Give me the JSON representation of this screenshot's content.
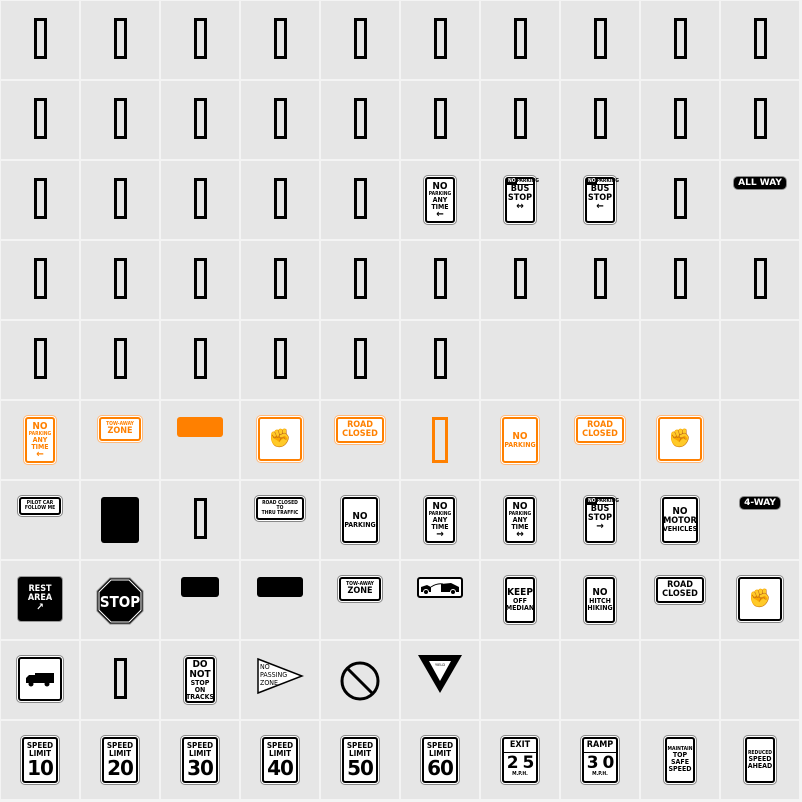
{
  "font_preview": {
    "background": "#e6e6e6",
    "accent_orange": "#ff8000",
    "columns": 10,
    "rows": 10,
    "cells": [
      {
        "type": "missing"
      },
      {
        "type": "missing"
      },
      {
        "type": "missing"
      },
      {
        "type": "missing"
      },
      {
        "type": "missing"
      },
      {
        "type": "missing"
      },
      {
        "type": "missing"
      },
      {
        "type": "missing"
      },
      {
        "type": "missing"
      },
      {
        "type": "missing"
      },
      {
        "type": "missing"
      },
      {
        "type": "missing"
      },
      {
        "type": "missing"
      },
      {
        "type": "missing"
      },
      {
        "type": "missing"
      },
      {
        "type": "missing"
      },
      {
        "type": "missing"
      },
      {
        "type": "missing"
      },
      {
        "type": "missing"
      },
      {
        "type": "missing"
      },
      {
        "type": "missing"
      },
      {
        "type": "missing"
      },
      {
        "type": "missing"
      },
      {
        "type": "missing"
      },
      {
        "type": "missing"
      },
      {
        "type": "sign",
        "name": "no-parking-any-time-left",
        "lines": [
          "NO",
          "PARKING",
          "ANY",
          "TIME"
        ],
        "arrow": "←"
      },
      {
        "type": "bus",
        "name": "no-parking-bus-stop-both",
        "head_no": "NO",
        "head": "PARKING",
        "lines": [
          "BUS",
          "STOP"
        ],
        "arrow": "↔"
      },
      {
        "type": "bus",
        "name": "no-parking-bus-stop-left",
        "head_no": "NO",
        "head": "PARKING",
        "lines": [
          "BUS",
          "STOP"
        ],
        "arrow": "←"
      },
      {
        "type": "missing"
      },
      {
        "type": "pill",
        "name": "all-way",
        "lines": [
          "ALL WAY"
        ]
      },
      {
        "type": "missing"
      },
      {
        "type": "missing"
      },
      {
        "type": "missing"
      },
      {
        "type": "missing"
      },
      {
        "type": "missing"
      },
      {
        "type": "missing"
      },
      {
        "type": "missing"
      },
      {
        "type": "missing"
      },
      {
        "type": "missing"
      },
      {
        "type": "missing"
      },
      {
        "type": "missing"
      },
      {
        "type": "missing"
      },
      {
        "type": "missing"
      },
      {
        "type": "missing"
      },
      {
        "type": "missing"
      },
      {
        "type": "missing"
      },
      {
        "type": "empty"
      },
      {
        "type": "empty"
      },
      {
        "type": "empty"
      },
      {
        "type": "empty"
      },
      {
        "type": "sign",
        "color": "orange",
        "name": "no-parking-any-time-left-orange",
        "lines": [
          "NO",
          "PARKING",
          "ANY",
          "TIME"
        ],
        "arrow": "←"
      },
      {
        "type": "wide",
        "color": "orange",
        "name": "tow-away-zone-orange",
        "lines": [
          "TOW-AWAY",
          "ZONE"
        ]
      },
      {
        "type": "block",
        "color": "orange",
        "name": "blank-panel-orange"
      },
      {
        "type": "hand",
        "color": "orange",
        "name": "hitchhiker-orange",
        "icon": "👍"
      },
      {
        "type": "wide",
        "color": "orange",
        "name": "road-closed-orange",
        "lines": [
          "ROAD",
          "CLOSED"
        ]
      },
      {
        "type": "missing",
        "color": "orange"
      },
      {
        "type": "square",
        "color": "orange",
        "name": "no-parking-orange",
        "lines": [
          "NO",
          "PARKING"
        ]
      },
      {
        "type": "wide",
        "color": "orange",
        "name": "road-closed-orange-2",
        "lines": [
          "ROAD",
          "CLOSED"
        ]
      },
      {
        "type": "hand",
        "color": "orange",
        "name": "hitchhiker-orange-2",
        "icon": "👍"
      },
      {
        "type": "empty"
      },
      {
        "type": "wide",
        "name": "pilot-car-follow-me",
        "lines": [
          "PILOT CAR",
          "FOLLOW ME"
        ]
      },
      {
        "type": "bigblock",
        "name": "blank-black-panel"
      },
      {
        "type": "missing"
      },
      {
        "type": "wide",
        "name": "road-closed-to-thru-traffic",
        "lines": [
          "ROAD CLOSED",
          "TO",
          "THRU TRAFFIC"
        ]
      },
      {
        "type": "square",
        "name": "no-parking",
        "lines": [
          "NO",
          "PARKING"
        ]
      },
      {
        "type": "sign",
        "name": "no-parking-any-time-right",
        "lines": [
          "NO",
          "PARKING",
          "ANY",
          "TIME"
        ],
        "arrow": "→"
      },
      {
        "type": "sign",
        "name": "no-parking-any-time-both",
        "lines": [
          "NO",
          "PARKING",
          "ANY",
          "TIME"
        ],
        "arrow": "↔"
      },
      {
        "type": "bus",
        "name": "no-parking-bus-stop-right",
        "head_no": "NO",
        "head": "PARKING",
        "lines": [
          "BUS",
          "STOP"
        ],
        "arrow": "→"
      },
      {
        "type": "square",
        "name": "no-motor-vehicles",
        "lines": [
          "NO",
          "MOTOR",
          "VEHICLES"
        ]
      },
      {
        "type": "pill",
        "name": "four-way",
        "lines": [
          "4-WAY"
        ]
      },
      {
        "type": "blacksq",
        "name": "rest-area",
        "lines": [
          "REST",
          "AREA"
        ],
        "arrow": "↗"
      },
      {
        "type": "stop",
        "name": "stop",
        "lines": [
          "STOP"
        ]
      },
      {
        "type": "block",
        "name": "blank-black-small"
      },
      {
        "type": "block",
        "name": "blank-black-wide"
      },
      {
        "type": "wide",
        "name": "tow-away-zone",
        "lines": [
          "TOW-AWAY",
          "ZONE"
        ]
      },
      {
        "type": "tow",
        "name": "tow-truck",
        "icon": "🚚"
      },
      {
        "type": "sign",
        "name": "keep-off-median",
        "lines": [
          "KEEP",
          "OFF",
          "MEDIAN"
        ]
      },
      {
        "type": "sign",
        "name": "no-hitch-hiking",
        "lines": [
          "NO",
          "HITCH",
          "HIKING"
        ]
      },
      {
        "type": "wide",
        "name": "road-closed",
        "lines": [
          "ROAD",
          "CLOSED"
        ]
      },
      {
        "type": "hand",
        "name": "hitchhiker",
        "icon": "👍"
      },
      {
        "type": "truck",
        "name": "truck-route",
        "icon": "🚚"
      },
      {
        "type": "missing"
      },
      {
        "type": "sign",
        "name": "do-not-stop-on-tracks",
        "lines": [
          "DO NOT",
          "STOP",
          "ON",
          "TRACKS"
        ]
      },
      {
        "type": "pennant",
        "name": "no-passing-zone",
        "lines": [
          "NO",
          "PASSING",
          "ZONE"
        ]
      },
      {
        "type": "prohibit",
        "name": "prohibition-symbol"
      },
      {
        "type": "yield",
        "name": "yield",
        "lines": [
          "YIELD"
        ]
      },
      {
        "type": "empty"
      },
      {
        "type": "empty"
      },
      {
        "type": "empty"
      },
      {
        "type": "empty"
      },
      {
        "type": "speed",
        "name": "speed-limit-10",
        "lines": [
          "SPEED",
          "LIMIT"
        ],
        "value": "10"
      },
      {
        "type": "speed",
        "name": "speed-limit-20",
        "lines": [
          "SPEED",
          "LIMIT"
        ],
        "value": "20"
      },
      {
        "type": "speed",
        "name": "speed-limit-30",
        "lines": [
          "SPEED",
          "LIMIT"
        ],
        "value": "30"
      },
      {
        "type": "speed",
        "name": "speed-limit-40",
        "lines": [
          "SPEED",
          "LIMIT"
        ],
        "value": "40"
      },
      {
        "type": "speed",
        "name": "speed-limit-50",
        "lines": [
          "SPEED",
          "LIMIT"
        ],
        "value": "50"
      },
      {
        "type": "speed",
        "name": "speed-limit-60",
        "lines": [
          "SPEED",
          "LIMIT"
        ],
        "value": "60"
      },
      {
        "type": "advisory",
        "name": "exit-25-mph",
        "head": "EXIT",
        "value": "2 5",
        "unit": "M.P.H."
      },
      {
        "type": "advisory",
        "name": "ramp-30-mph",
        "head": "RAMP",
        "value": "3 0",
        "unit": "M.P.H."
      },
      {
        "type": "sign",
        "name": "maintain-top-safe-speed",
        "lines": [
          "MAINTAIN",
          "TOP",
          "SAFE",
          "SPEED"
        ]
      },
      {
        "type": "sign",
        "name": "reduced-speed-ahead",
        "lines": [
          "REDUCED",
          "SPEED",
          "AHEAD"
        ]
      }
    ]
  }
}
